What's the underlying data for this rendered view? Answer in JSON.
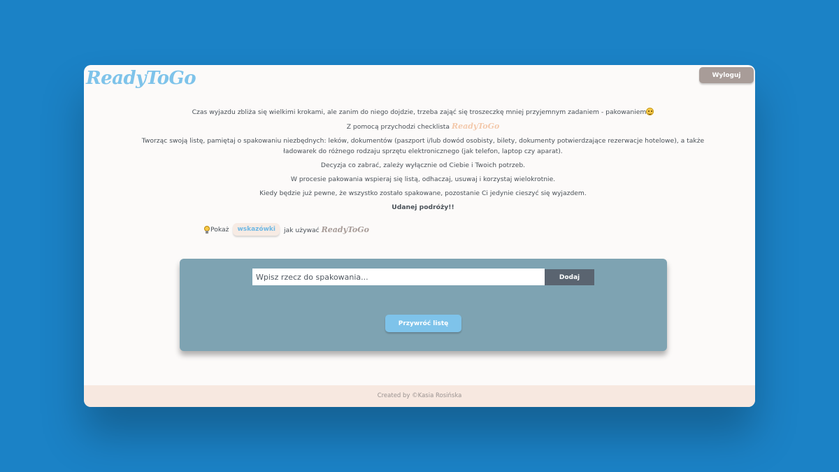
{
  "header": {
    "logo_text": "ReadyToGo",
    "logout_label": "Wyloguj"
  },
  "intro": {
    "line1": "Czas wyjazdu zbliża się wielkimi krokami, ale zanim do niego dojdzie, trzeba zająć się troszeczkę mniej przyjemnym zadaniem - pakowaniem",
    "line2_prefix": "Z pomocą przychodzi checklista",
    "line2_logo": "ReadyToGo",
    "line3": "Tworząc swoją listę, pamiętaj o spakowaniu niezbędnych: leków, dokumentów (paszport i/lub dowód osobisty, bilety, dokumenty potwierdzające rezerwacje hotelowe), a także ładowarek do różnego rodzaju sprzętu elektronicznego (jak telefon, laptop czy aparat).",
    "line4": "Decyzja co zabrać, zależy wyłącznie od Ciebie i Twoich potrzeb.",
    "line5": "W procesie pakowania wspieraj się listą, odhaczaj, usuwaj i korzystaj wielokrotnie.",
    "line6": "Kiedy będzie już pewne, że wszystko zostało spakowane, pozostanie Ci jedynie cieszyć się wyjazdem.",
    "line7": "Udanej podróży!!"
  },
  "hints": {
    "prefix": "Pokaż",
    "button_label": "wskazówki",
    "suffix": "jak używać",
    "logo": "ReadyToGo"
  },
  "packing": {
    "input_placeholder": "Wpisz rzecz do spakowania...",
    "add_label": "Dodaj",
    "restore_label": "Przywróć listę"
  },
  "footer": {
    "text": "Created by ©Kasia Rosińska"
  },
  "colors": {
    "background": "#1b82c6",
    "accent_blue": "#7ec3ea",
    "panel": "#7ea3b2",
    "logout": "#a89c98",
    "footer_bg": "#f7e8e0"
  }
}
